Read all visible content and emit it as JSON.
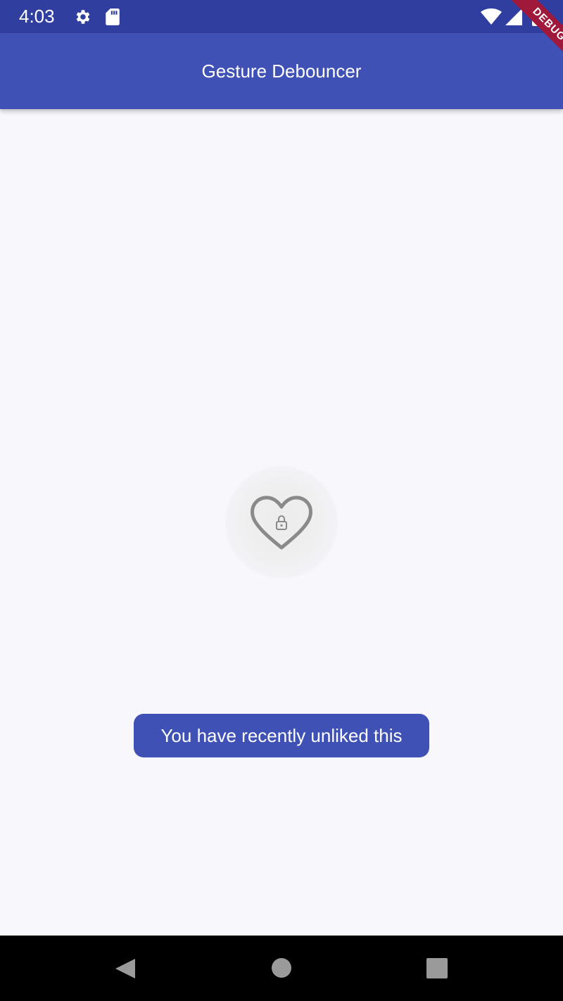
{
  "status_bar": {
    "time": "4:03",
    "icons": [
      "gear-icon",
      "sd-card-icon",
      "wifi-icon",
      "signal-icon",
      "battery-icon"
    ]
  },
  "app_bar": {
    "title": "Gesture Debouncer",
    "color": "#3f51b5"
  },
  "debug_banner": {
    "label": "DEBUG"
  },
  "like_button": {
    "icon": "heart-lock-icon"
  },
  "snackbar": {
    "message": "You have recently unliked this"
  },
  "nav_bar": {
    "buttons": [
      "back-icon",
      "home-icon",
      "recents-icon"
    ]
  },
  "colors": {
    "status_bar": "#303f9f",
    "primary": "#3f51b5",
    "background": "#f8f7fc",
    "debug": "#a0183a"
  }
}
